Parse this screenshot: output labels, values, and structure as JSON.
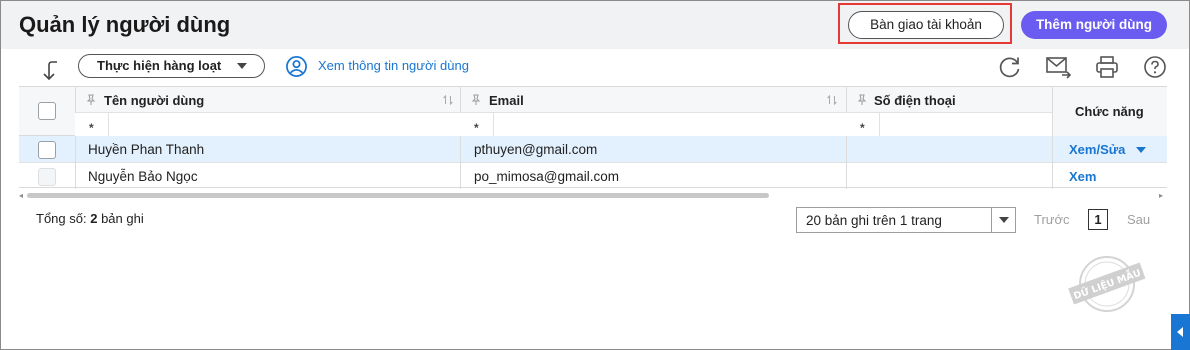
{
  "header": {
    "title": "Quản lý người dùng",
    "handover_label": "Bàn giao tài khoản",
    "add_user_label": "Thêm người dùng"
  },
  "toolbar": {
    "bulk_action_label": "Thực hiện hàng loạt",
    "view_user_info_label": "Xem thông tin người dùng",
    "icons": [
      "collapse-arrow-icon",
      "refresh-icon",
      "send-mail-icon",
      "print-icon",
      "help-icon"
    ]
  },
  "table": {
    "columns": {
      "name": "Tên người dùng",
      "email": "Email",
      "phone": "Số điện thoại",
      "function": "Chức năng"
    },
    "filter_placeholder": "*",
    "rows": [
      {
        "name": "Huyền Phan Thanh",
        "email": "pthuyen@gmail.com",
        "phone": "",
        "action": "Xem/Sửa",
        "selected": true
      },
      {
        "name": "Nguyễn Bảo Ngọc",
        "email": "po_mimosa@gmail.com",
        "phone": "",
        "action": "Xem",
        "selected": false
      }
    ]
  },
  "footer": {
    "total_prefix": "Tổng số:",
    "total_count": "2",
    "total_suffix": "bản ghi",
    "page_size": "20 bản ghi trên 1 trang",
    "prev": "Trước",
    "page": "1",
    "next": "Sau"
  },
  "watermark": "DỮ LIỆU MẪU",
  "colors": {
    "accent": "#6a5cf0",
    "link": "#1976d2",
    "highlight": "#e53935",
    "selected_row": "#e3f0fd"
  }
}
